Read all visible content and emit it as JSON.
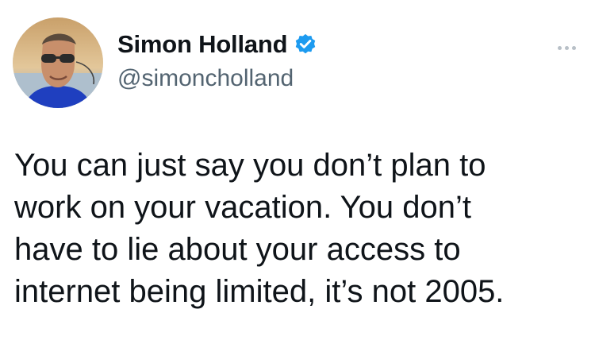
{
  "author": {
    "display_name": "Simon Holland",
    "handle": "@simoncholland",
    "verified": true,
    "avatar_icon": "profile-photo"
  },
  "tweet": {
    "lines": [
      "You can just say you don’t plan to",
      "work on your vacation. You don’t",
      "have to lie about your access to",
      "internet being limited, it’s not 2005."
    ]
  },
  "icons": {
    "verified": "verified-badge-icon",
    "more": "more-options-icon"
  },
  "colors": {
    "verified_blue": "#1d9bf0",
    "handle_gray": "#536471",
    "text": "#0f1419"
  }
}
